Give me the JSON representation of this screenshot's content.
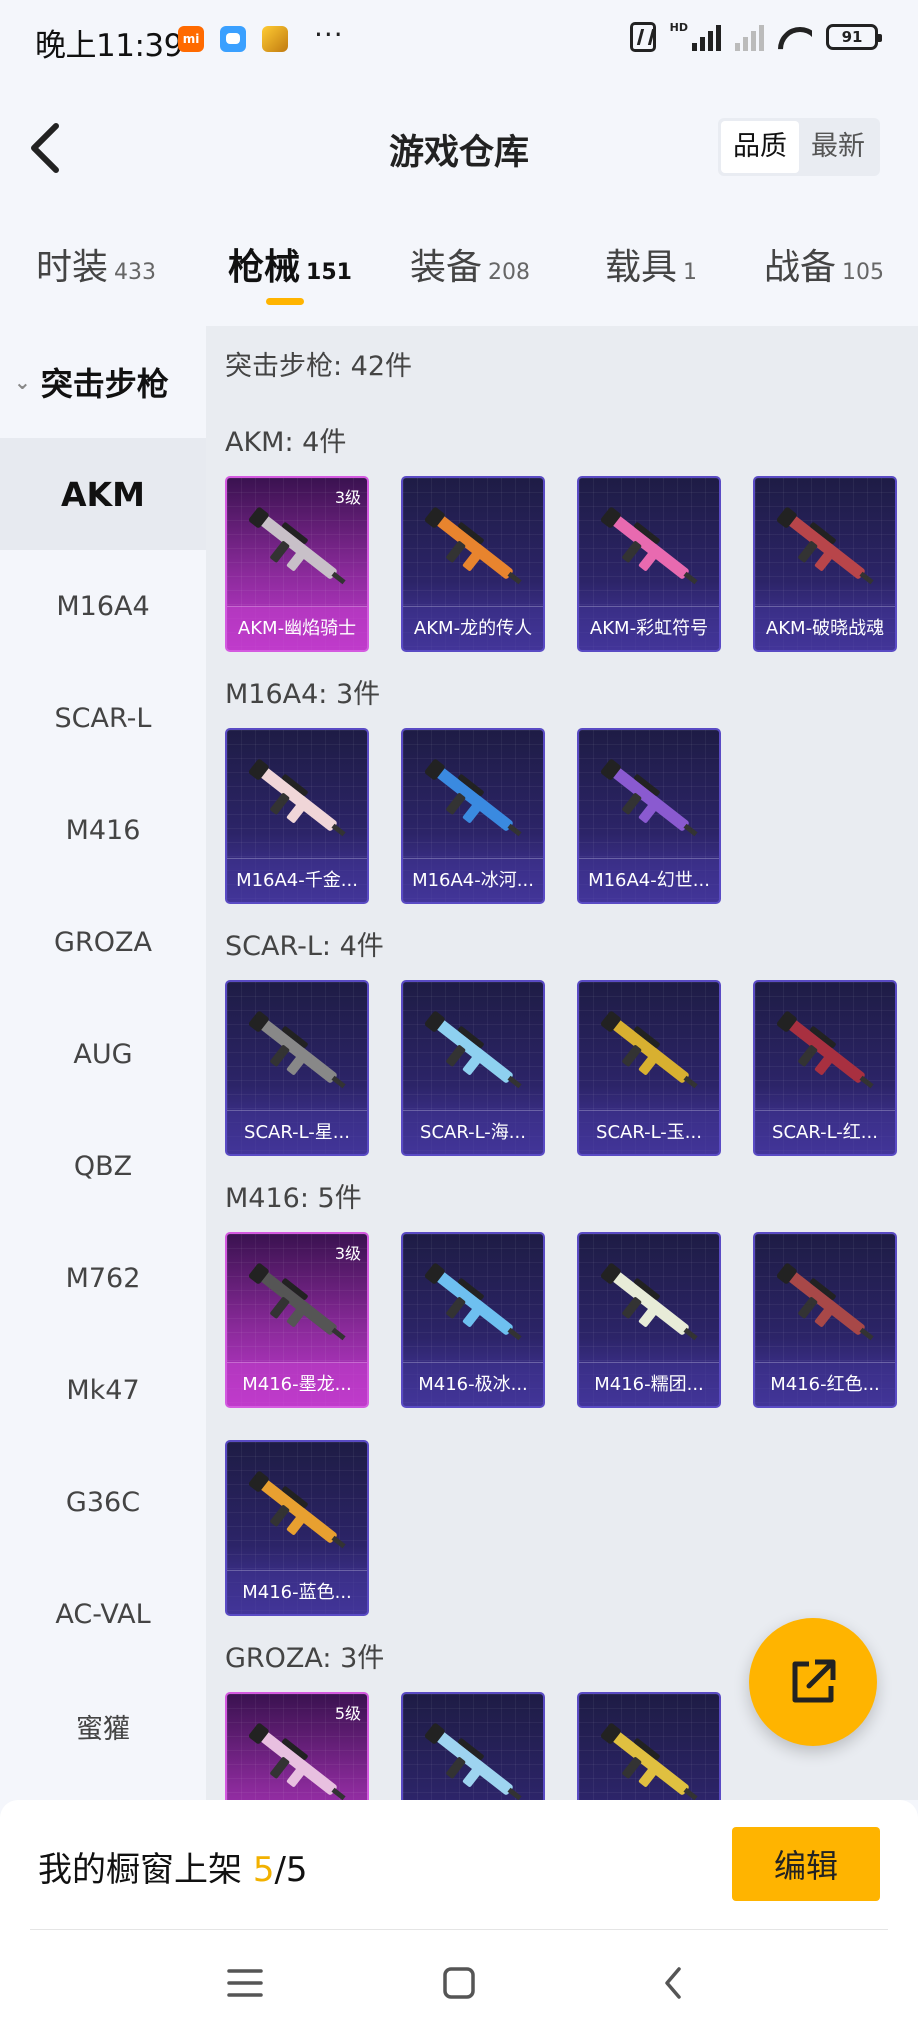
{
  "status_bar": {
    "time": "晚上11:39",
    "mi_label": "mi",
    "more": "···",
    "hd": "HD",
    "battery": "91"
  },
  "header": {
    "title": "游戏仓库",
    "sort_options": [
      "品质",
      "最新"
    ]
  },
  "tabs": [
    {
      "label": "时装",
      "count": "433"
    },
    {
      "label": "枪械",
      "count": "151"
    },
    {
      "label": "装备",
      "count": "208"
    },
    {
      "label": "载具",
      "count": "1"
    },
    {
      "label": "战备",
      "count": "105"
    }
  ],
  "sidebar": {
    "group": "突击步枪",
    "items": [
      "AKM",
      "M16A4",
      "SCAR-L",
      "M416",
      "GROZA",
      "AUG",
      "QBZ",
      "M762",
      "Mk47",
      "G36C",
      "AC-VAL",
      "蜜獾"
    ]
  },
  "content": {
    "header": "突击步枪: 42件",
    "sections": [
      {
        "title": "AKM: 4件",
        "items": [
          {
            "name": "AKM-幽焰骑士",
            "level": "3级"
          },
          {
            "name": "AKM-龙的传人",
            "level": ""
          },
          {
            "name": "AKM-彩虹符号",
            "level": ""
          },
          {
            "name": "AKM-破晓战魂",
            "level": ""
          }
        ]
      },
      {
        "title": "M16A4: 3件",
        "items": [
          {
            "name": "M16A4-千金...",
            "level": ""
          },
          {
            "name": "M16A4-冰河...",
            "level": ""
          },
          {
            "name": "M16A4-幻世...",
            "level": ""
          }
        ]
      },
      {
        "title": "SCAR-L: 4件",
        "items": [
          {
            "name": "SCAR-L-星...",
            "level": ""
          },
          {
            "name": "SCAR-L-海...",
            "level": ""
          },
          {
            "name": "SCAR-L-玉...",
            "level": ""
          },
          {
            "name": "SCAR-L-红...",
            "level": ""
          }
        ]
      },
      {
        "title": "M416: 5件",
        "items": [
          {
            "name": "M416-墨龙...",
            "level": "3级"
          },
          {
            "name": "M416-极冰...",
            "level": ""
          },
          {
            "name": "M416-糯团...",
            "level": ""
          },
          {
            "name": "M416-红色...",
            "level": ""
          },
          {
            "name": "M416-蓝色...",
            "level": ""
          }
        ]
      },
      {
        "title": "GROZA: 3件",
        "items": [
          {
            "name": "",
            "level": "5级"
          },
          {
            "name": "",
            "level": ""
          },
          {
            "name": "",
            "level": ""
          }
        ]
      }
    ]
  },
  "bottom": {
    "showcase_label": "我的橱窗上架",
    "showcase_count": "5",
    "showcase_total": "/5",
    "edit": "编辑"
  },
  "colors": {
    "accent": "#ffb400",
    "card_blue": "#2c2468",
    "card_purple": "#8a2a9a"
  },
  "icons": {
    "back": "back-arrow-icon",
    "share": "external-link-icon",
    "nav_menu": "menu-icon",
    "nav_home": "home-square-icon",
    "nav_back": "nav-back-icon"
  }
}
